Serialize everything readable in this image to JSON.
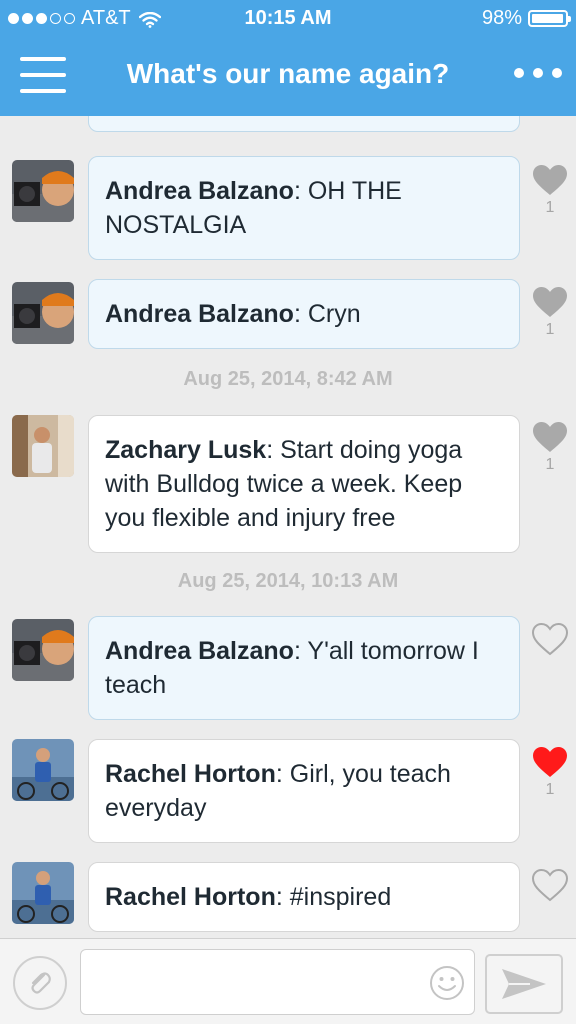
{
  "status_bar": {
    "carrier": "AT&T",
    "time": "10:15 AM",
    "battery": "98%",
    "signal_bars_filled": 3,
    "signal_bars_total": 5,
    "battery_level": 0.98
  },
  "nav": {
    "title": "What's our name again?",
    "menu_icon": "hamburger-menu-icon",
    "more_icon": "more-dots-icon"
  },
  "messages": [
    {
      "author": "Andrea Balzano",
      "text": "OH THE NOSTALGIA",
      "style": "mine",
      "liked": false,
      "likes": "1"
    },
    {
      "author": "Andrea Balzano",
      "text": "Cryn",
      "style": "mine",
      "liked": false,
      "likes": "1"
    },
    {
      "timestamp": "Aug 25, 2014, 8:42 AM"
    },
    {
      "author": "Zachary Lusk",
      "text": "Start doing yoga with Bulldog twice a week. Keep you flexible and injury free",
      "style": "theirs",
      "liked": false,
      "likes": "1"
    },
    {
      "timestamp": "Aug 25, 2014, 10:13 AM"
    },
    {
      "author": "Andrea Balzano",
      "text": "Y'all tomorrow I teach",
      "style": "mine",
      "liked": false,
      "likes": ""
    },
    {
      "author": "Rachel Horton",
      "text": "Girl, you teach everyday",
      "style": "theirs",
      "liked": true,
      "likes": "1"
    },
    {
      "author": "Rachel Horton",
      "text": "#inspired",
      "style": "theirs",
      "liked": false,
      "likes": ""
    }
  ],
  "composer": {
    "input_value": "",
    "input_placeholder": "",
    "attach_icon": "paperclip-icon",
    "emoji_icon": "smiley-icon",
    "send_icon": "send-arrow-icon"
  },
  "colors": {
    "header_blue": "#4aa6e6",
    "liked_red": "#ff1a1a",
    "like_gray": "#a9a9a9",
    "mine_bubble": "#eef7fd",
    "theirs_bubble": "#ffffff"
  }
}
